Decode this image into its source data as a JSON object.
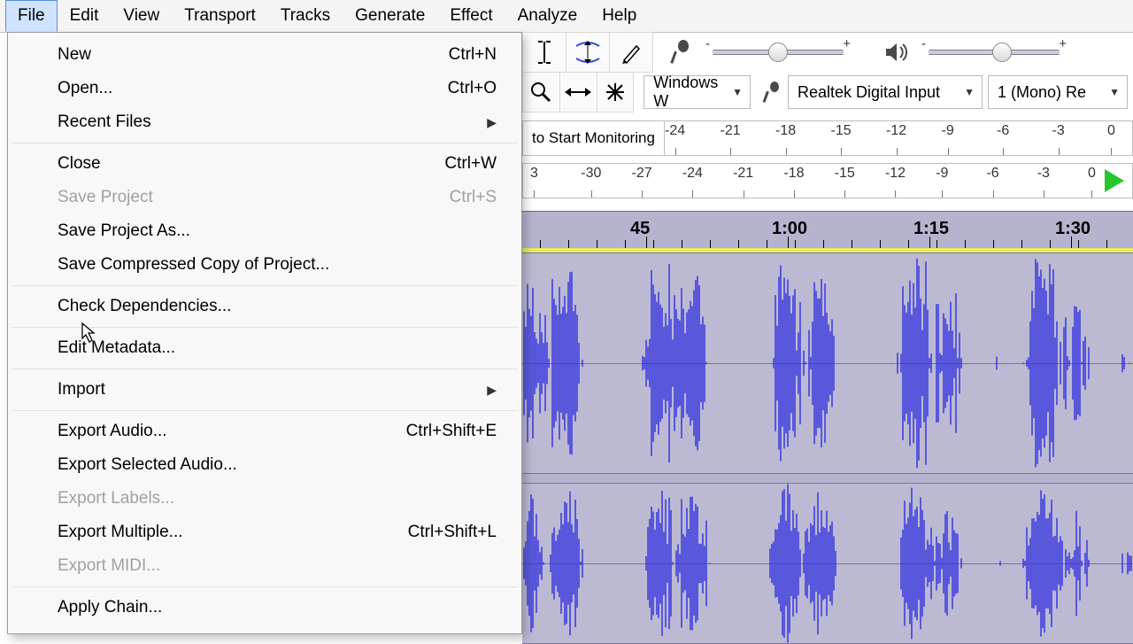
{
  "menubar": [
    "File",
    "Edit",
    "View",
    "Transport",
    "Tracks",
    "Generate",
    "Effect",
    "Analyze",
    "Help"
  ],
  "file_menu": [
    {
      "label": "New",
      "shortcut": "Ctrl+N"
    },
    {
      "label": "Open...",
      "shortcut": "Ctrl+O"
    },
    {
      "label": "Recent Files",
      "submenu": true
    },
    {
      "sep": true
    },
    {
      "label": "Close",
      "shortcut": "Ctrl+W"
    },
    {
      "label": "Save Project",
      "shortcut": "Ctrl+S",
      "disabled": true
    },
    {
      "label": "Save Project As..."
    },
    {
      "label": "Save Compressed Copy of Project..."
    },
    {
      "sep": true
    },
    {
      "label": "Check Dependencies..."
    },
    {
      "sep": true
    },
    {
      "label": "Edit Metadata..."
    },
    {
      "sep": true
    },
    {
      "label": "Import",
      "submenu": true
    },
    {
      "sep": true
    },
    {
      "label": "Export Audio...",
      "shortcut": "Ctrl+Shift+E"
    },
    {
      "label": "Export Selected Audio..."
    },
    {
      "label": "Export Labels...",
      "disabled": true
    },
    {
      "label": "Export Multiple...",
      "shortcut": "Ctrl+Shift+L"
    },
    {
      "label": "Export MIDI...",
      "disabled": true
    },
    {
      "sep": true
    },
    {
      "label": "Apply Chain..."
    }
  ],
  "device_row": {
    "host": "Windows W",
    "input": "Realtek Digital Input",
    "channels": "1 (Mono) Re"
  },
  "monitor_hint": "to Start Monitoring",
  "db_ticks": [
    "-24",
    "-21",
    "-18",
    "-15",
    "-12",
    "-9",
    "-6",
    "-3",
    "0"
  ],
  "db_ticks2": [
    "3",
    "-30",
    "-27",
    "-24",
    "-21",
    "-18",
    "-15",
    "-12",
    "-9",
    "-6",
    "-3",
    "0"
  ],
  "timeline_labels": [
    "45",
    "1:00",
    "1:15",
    "1:30"
  ],
  "sliders": {
    "rec_end_minus": "-",
    "rec_end_plus": "+",
    "play_end_minus": "-",
    "play_end_plus": "+"
  }
}
